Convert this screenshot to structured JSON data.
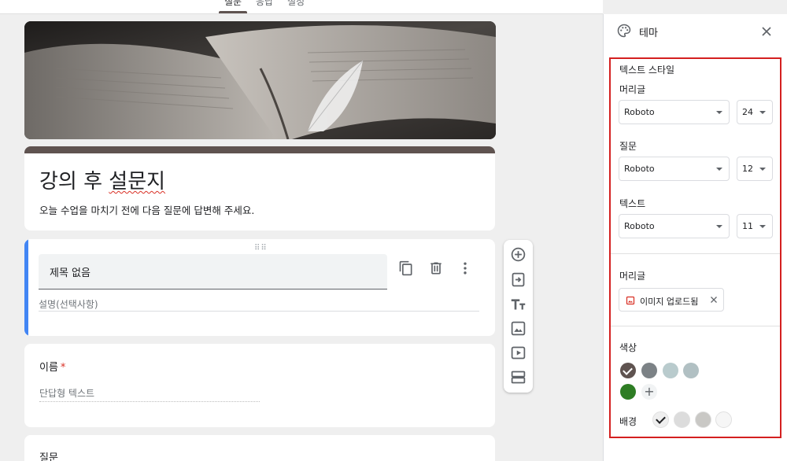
{
  "tabs": [
    {
      "label": "질문",
      "active": true
    },
    {
      "label": "응답",
      "active": false
    },
    {
      "label": "설정",
      "active": false
    }
  ],
  "form": {
    "title_prefix": "강의 후 ",
    "title_underlined": "설문지",
    "description": "오늘 수업을 마치기 전에 다음 질문에 답변해 주세요."
  },
  "section": {
    "title_value": "제목 없음",
    "description_placeholder": "설명(선택사항)"
  },
  "questions": [
    {
      "label": "이름",
      "required_mark": "*",
      "answer_placeholder": "단답형 텍스트"
    },
    {
      "label": "질문"
    }
  ],
  "toolbar_icons": [
    "add-question-icon",
    "import-questions-icon",
    "add-title-icon",
    "add-image-icon",
    "add-video-icon",
    "add-section-icon"
  ],
  "theme_panel": {
    "title": "테마",
    "text_style_heading": "텍스트 스타일",
    "header": {
      "label": "머리글",
      "font": "Roboto",
      "size": "24"
    },
    "question": {
      "label": "질문",
      "font": "Roboto",
      "size": "12"
    },
    "text": {
      "label": "텍스트",
      "font": "Roboto",
      "size": "11"
    },
    "header_image_label": "머리글",
    "image_chip_label": "이미지 업로드됨",
    "color_label": "색상",
    "colors": [
      "#5f5350",
      "#7c8286",
      "#b9cbcd",
      "#b1c0c3",
      "#2e7d24"
    ],
    "selected_color": "#5f5350",
    "background_label": "배경",
    "backgrounds": [
      "#efefef",
      "#dcdcdc",
      "#c9c8c5",
      "#f6f6f6"
    ],
    "selected_background": "#efefef"
  }
}
